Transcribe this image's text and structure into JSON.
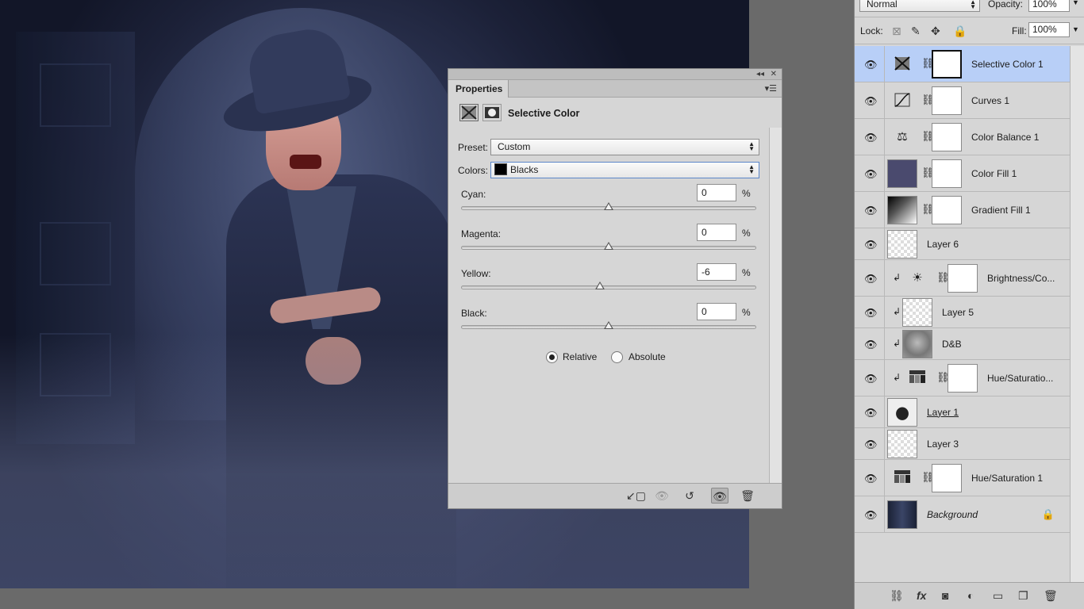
{
  "properties": {
    "tab_label": "Properties",
    "adjustment_title": "Selective Color",
    "preset_label": "Preset:",
    "preset_value": "Custom",
    "colors_label": "Colors:",
    "colors_value": "Blacks",
    "sliders": [
      {
        "label": "Cyan:",
        "value": "0",
        "unit": "%",
        "level": 0
      },
      {
        "label": "Magenta:",
        "value": "0",
        "unit": "%",
        "level": 0
      },
      {
        "label": "Yellow:",
        "value": "-6",
        "unit": "%",
        "level": -6
      },
      {
        "label": "Black:",
        "value": "0",
        "unit": "%",
        "level": 0
      }
    ],
    "method": {
      "relative": "Relative",
      "absolute": "Absolute",
      "selected": "Relative"
    }
  },
  "layers": {
    "blend_mode": "Normal",
    "opacity_label": "Opacity:",
    "opacity_value": "100%",
    "lock_label": "Lock:",
    "fill_label": "Fill:",
    "fill_value": "100%",
    "items": [
      {
        "name": "Selective Color 1",
        "icon": "selective-color-icon"
      },
      {
        "name": "Curves 1",
        "icon": "curves-icon"
      },
      {
        "name": "Color Balance 1",
        "icon": "color-balance-icon"
      },
      {
        "name": "Color Fill 1",
        "icon": "color-fill-icon",
        "fill_color": "#4a4a6e"
      },
      {
        "name": "Gradient Fill 1",
        "icon": "gradient-fill-icon"
      },
      {
        "name": "Layer 6",
        "icon": "pixel-layer"
      },
      {
        "name": "Brightness/Co...",
        "icon": "brightness-icon"
      },
      {
        "name": "Layer 5",
        "icon": "pixel-layer"
      },
      {
        "name": "D&B",
        "icon": "pixel-layer"
      },
      {
        "name": "Hue/Saturatio...",
        "icon": "hue-saturation-icon"
      },
      {
        "name": "Layer 1",
        "icon": "pixel-layer"
      },
      {
        "name": "Layer 3",
        "icon": "pixel-layer"
      },
      {
        "name": "Hue/Saturation 1",
        "icon": "hue-saturation-icon"
      },
      {
        "name": "Background",
        "icon": "pixel-layer"
      }
    ]
  }
}
